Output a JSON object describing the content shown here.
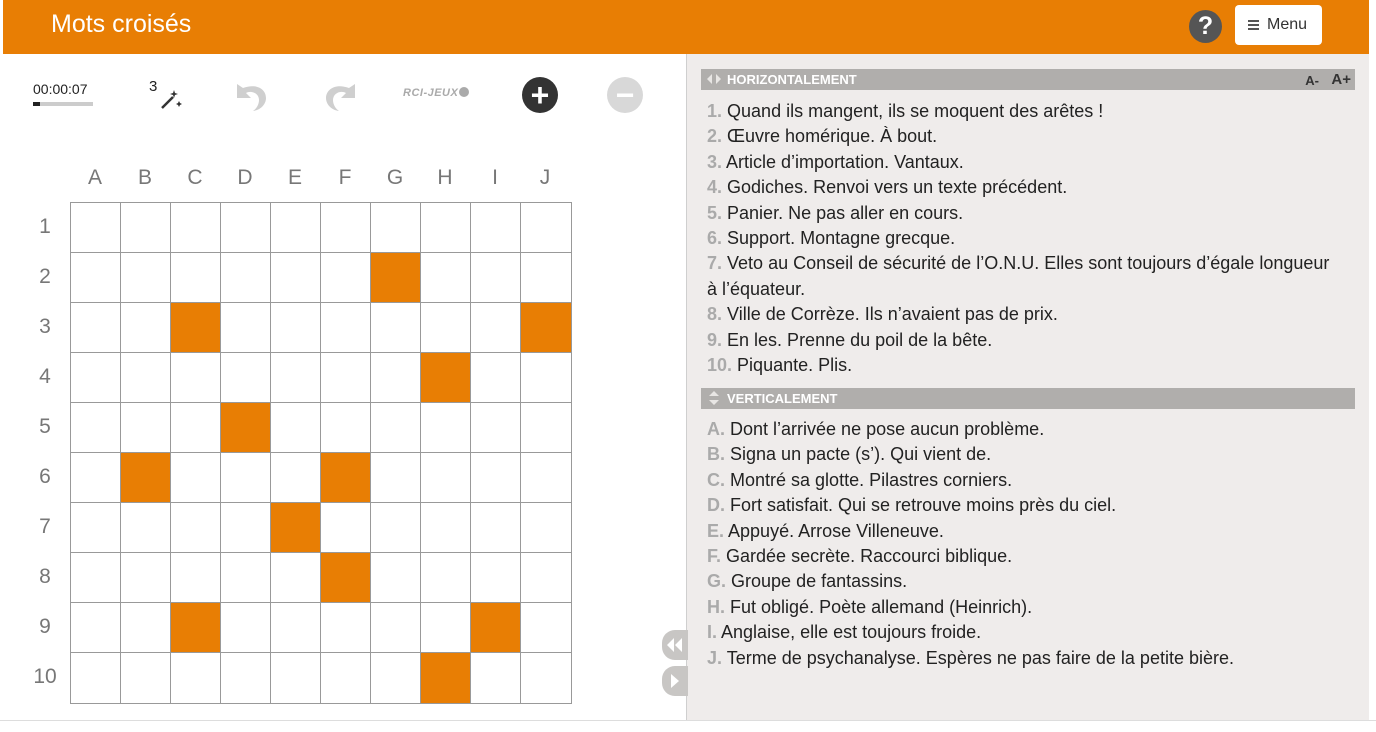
{
  "header": {
    "title": "Mots croisés",
    "help_label": "?",
    "menu_label": "Menu"
  },
  "toolbar": {
    "timer": "00:00:07",
    "timer_progress": 0.12,
    "hint_count": "3",
    "logo_text": "RCI-JEUX",
    "zoom_in_label": "+",
    "zoom_out_label": "−"
  },
  "grid": {
    "columns": [
      "A",
      "B",
      "C",
      "D",
      "E",
      "F",
      "G",
      "H",
      "I",
      "J"
    ],
    "rows": [
      "1",
      "2",
      "3",
      "4",
      "5",
      "6",
      "7",
      "8",
      "9",
      "10"
    ],
    "black_cells": [
      [
        2,
        7
      ],
      [
        3,
        3
      ],
      [
        3,
        10
      ],
      [
        4,
        8
      ],
      [
        5,
        4
      ],
      [
        6,
        2
      ],
      [
        6,
        6
      ],
      [
        7,
        5
      ],
      [
        8,
        6
      ],
      [
        9,
        3
      ],
      [
        9,
        9
      ],
      [
        10,
        8
      ]
    ],
    "accent_color": "#e87e04"
  },
  "clues": {
    "font_dec_label": "A-",
    "font_inc_label": "A+",
    "horizontal": {
      "heading": "HORIZONTALEMENT",
      "items": [
        {
          "num": "1.",
          "text": "Quand ils mangent, ils se moquent des arêtes !"
        },
        {
          "num": "2.",
          "text": "Œuvre homérique. À bout."
        },
        {
          "num": "3.",
          "text": "Article d’importation. Vantaux."
        },
        {
          "num": "4.",
          "text": "Godiches. Renvoi vers un texte précédent."
        },
        {
          "num": "5.",
          "text": "Panier. Ne pas aller en cours."
        },
        {
          "num": "6.",
          "text": "Support. Montagne grecque."
        },
        {
          "num": "7.",
          "text": "Veto au Conseil de sécurité de l’O.N.U. Elles sont toujours d’égale longueur à l’équateur."
        },
        {
          "num": "8.",
          "text": "Ville de Corrèze. Ils n’avaient pas de prix."
        },
        {
          "num": "9.",
          "text": "En les. Prenne du poil de la bête."
        },
        {
          "num": "10.",
          "text": "Piquante. Plis."
        }
      ]
    },
    "vertical": {
      "heading": "VERTICALEMENT",
      "items": [
        {
          "num": "A.",
          "text": "Dont l’arrivée ne pose aucun problème."
        },
        {
          "num": "B.",
          "text": "Signa un pacte (s’). Qui vient de."
        },
        {
          "num": "C.",
          "text": "Montré sa glotte. Pilastres corniers."
        },
        {
          "num": "D.",
          "text": "Fort satisfait. Qui se retrouve moins près du ciel."
        },
        {
          "num": "E.",
          "text": "Appuyé. Arrose Villeneuve."
        },
        {
          "num": "F.",
          "text": "Gardée secrète. Raccourci biblique."
        },
        {
          "num": "G.",
          "text": "Groupe de fantassins."
        },
        {
          "num": "H.",
          "text": "Fut obligé. Poète allemand (Heinrich)."
        },
        {
          "num": "I.",
          "text": "Anglaise, elle est toujours froide."
        },
        {
          "num": "J.",
          "text": "Terme de psychanalyse. Espères ne pas faire de la petite bière."
        }
      ]
    }
  }
}
